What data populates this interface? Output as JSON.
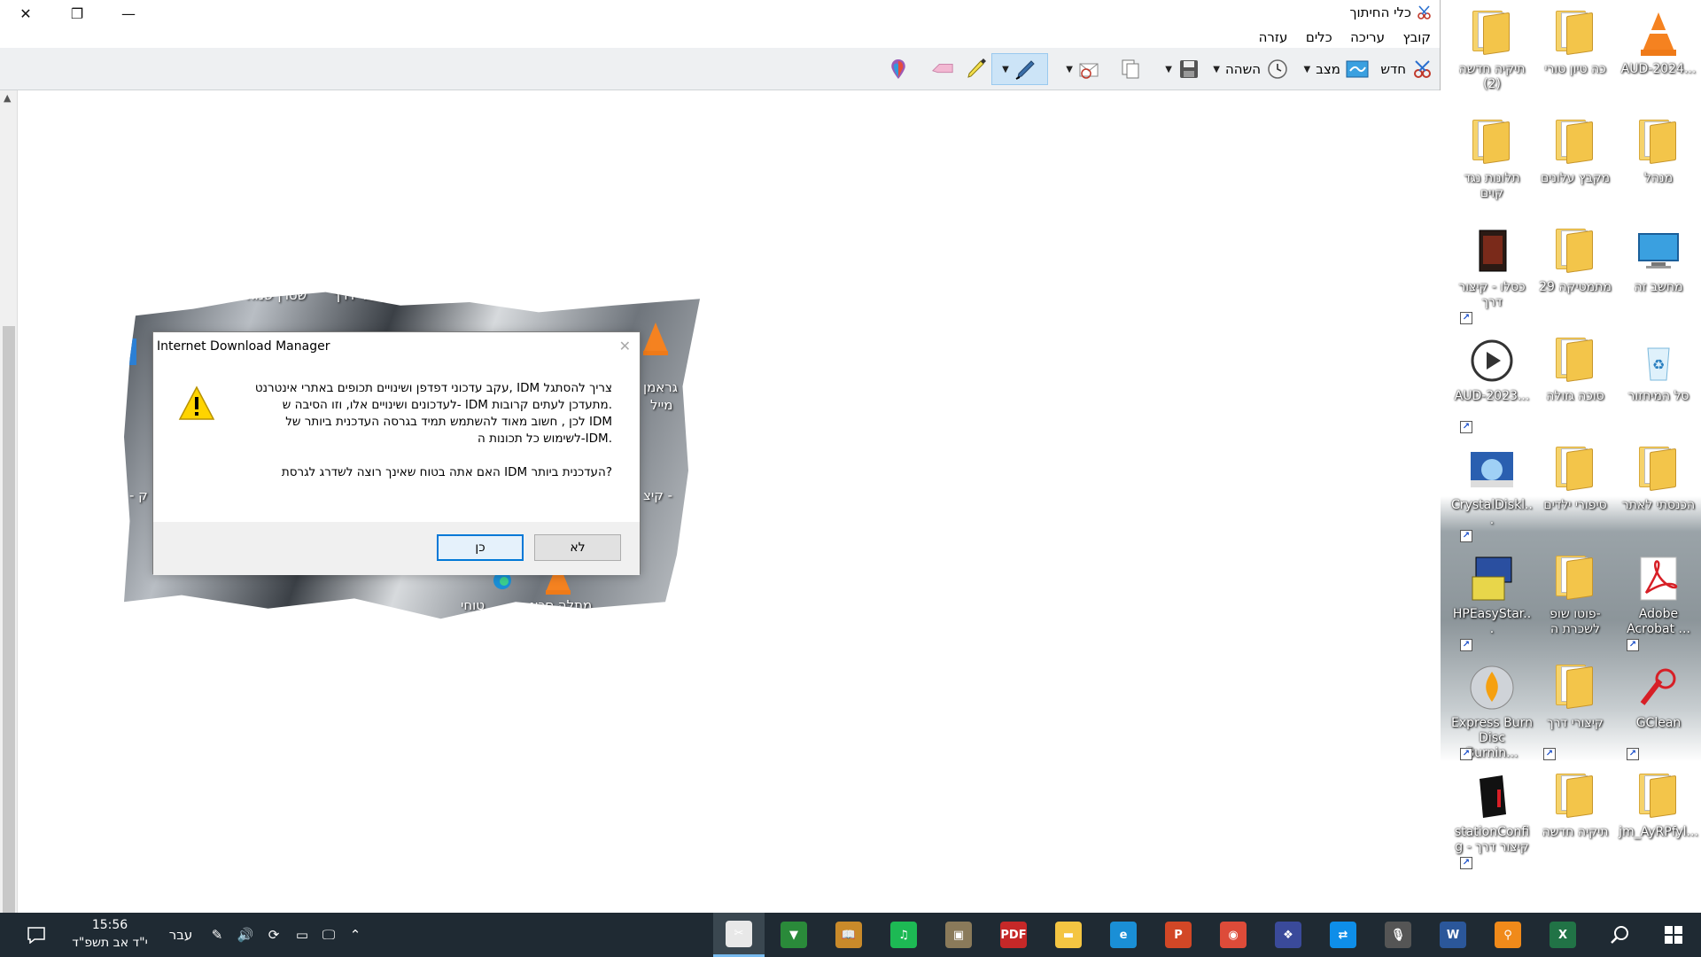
{
  "window": {
    "title": "כלי החיתוך",
    "controls": {
      "close": "✕",
      "restore": "❐",
      "minimize": "—"
    }
  },
  "menu": [
    "קובץ",
    "עריכה",
    "כלים",
    "עזרה"
  ],
  "toolbar": {
    "new_label": "חדש",
    "mode_label": "מצב",
    "delay_label": "השהה"
  },
  "snippet": {
    "texts": [
      "קיצור דרך",
      "שטרן שמח",
      "גראמן",
      "מייל",
      "- קיצ",
      "ק -",
      "מתלה סכינ",
      "טוחי"
    ]
  },
  "dialog": {
    "title": "Internet Download Manager",
    "close": "✕",
    "lines": [
      "צריך להסתגל IDM ,עקב עדכוני דפדפן ושינויים תכופים באתרי אינטרנט",
      ".מתעדכן לעתים קרובות IDM -לעדכונים ושינויים אלו, וזו הסיבה ש",
      "IDM לכן , חשוב מאוד להשתמש תמיד בגרסה העדכנית ביותר של",
      ".IDM-לשימוש כל תכונות ה",
      "",
      "?העדכנית ביותר IDM האם אתה בטוח שאינך רוצה לשדרג לגרסת"
    ],
    "yes_label": "כן",
    "no_label": "לא"
  },
  "desktop": {
    "icons": [
      {
        "label": "AUD-2024...",
        "icon": "vlc-icon"
      },
      {
        "label": "כה טיון טורי",
        "icon": "folder-icon"
      },
      {
        "label": "תיקיה חדשה (2)",
        "icon": "folder-icon"
      },
      {
        "label": "מנהל",
        "icon": "user-folder-icon"
      },
      {
        "label": "מקבץ עלונים",
        "icon": "folder-icon"
      },
      {
        "label": "תלונות נגד קוים",
        "icon": "folder-icon"
      },
      {
        "label": "מחשב זה",
        "icon": "computer-icon"
      },
      {
        "label": "מתמטיקה 29",
        "icon": "folder-icon"
      },
      {
        "label": "כסלו - קיצור דרך",
        "icon": "book-icon"
      },
      {
        "label": "סל המיחזור",
        "icon": "recycle-bin-icon"
      },
      {
        "label": "סוכה גזולה",
        "icon": "folder-icon"
      },
      {
        "label": "AUD-2023...",
        "icon": "media-player-icon"
      },
      {
        "label": "הכנסתי לאתר",
        "icon": "folder-icon"
      },
      {
        "label": "סיפורי ילדים",
        "icon": "folder-icon"
      },
      {
        "label": "CrystalDiskl...",
        "icon": "crystaldisk-icon"
      },
      {
        "label": "Adobe Acrobat ...",
        "icon": "acrobat-icon"
      },
      {
        "label": "-פוטו שופ לשכרת ה",
        "icon": "folder-icon"
      },
      {
        "label": "HPEasyStar...",
        "icon": "hp-installer-icon"
      },
      {
        "label": "GClean",
        "icon": "gclean-icon"
      },
      {
        "label": "קיצורי דרך",
        "icon": "shortcut-folder-icon"
      },
      {
        "label": "Express Burn Disc Burnin...",
        "icon": "express-burn-icon"
      },
      {
        "label": "jm_AyRPfyl...",
        "icon": "folder-icon"
      },
      {
        "label": "תיקיה חדשה",
        "icon": "folder-icon"
      },
      {
        "label": "stationConfig - קיצור דרך",
        "icon": "station-config-icon"
      }
    ]
  },
  "taskbar": {
    "time": "15:56",
    "date": "י\"ד אב תשפ\"ד",
    "language": "עבר",
    "apps": [
      {
        "name": "snipping-tool",
        "label": "✂",
        "color": "#e8e8e8"
      },
      {
        "name": "idm",
        "label": "▼",
        "color": "#2a8a3a"
      },
      {
        "name": "book-app",
        "label": "📖",
        "color": "#c98a2a"
      },
      {
        "name": "spotify",
        "label": "♫",
        "color": "#1db954"
      },
      {
        "name": "photo-app",
        "label": "▣",
        "color": "#8a7a5a"
      },
      {
        "name": "pdf-app",
        "label": "PDF",
        "color": "#c62828"
      },
      {
        "name": "file-explorer",
        "label": "▬",
        "color": "#f4c542"
      },
      {
        "name": "edge",
        "label": "e",
        "color": "#1a8fd6"
      },
      {
        "name": "powerpoint",
        "label": "P",
        "color": "#d24726"
      },
      {
        "name": "chrome",
        "label": "◉",
        "color": "#dd4b39"
      },
      {
        "name": "reader-app",
        "label": "❖",
        "color": "#3a4a9a"
      },
      {
        "name": "teamviewer",
        "label": "⇄",
        "color": "#0e8ee9"
      },
      {
        "name": "microphone-app",
        "label": "🎙",
        "color": "#555"
      },
      {
        "name": "word",
        "label": "W",
        "color": "#2b579a"
      },
      {
        "name": "search-app",
        "label": "⚲",
        "color": "#f08a1a"
      },
      {
        "name": "excel",
        "label": "X",
        "color": "#217346"
      }
    ]
  }
}
